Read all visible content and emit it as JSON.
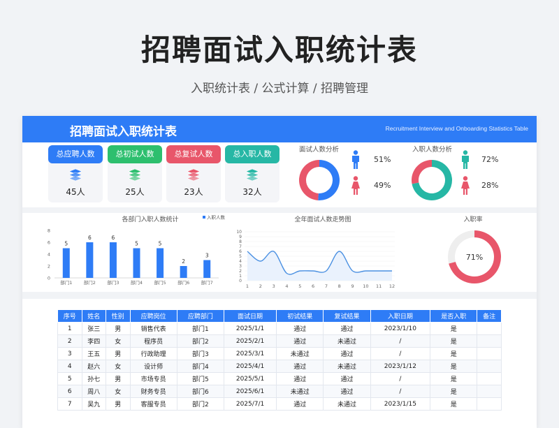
{
  "page": {
    "title": "招聘面试入职统计表",
    "subtitle": "入职统计表 / 公式计算 / 招聘管理"
  },
  "sheet": {
    "title": "招聘面试入职统计表",
    "en_title": "Recruitment Interview and Onboarding Statistics Table"
  },
  "kpis": [
    {
      "label": "总应聘人数",
      "value": "45人",
      "color": "#2e7cf6",
      "icon": "layers-icon"
    },
    {
      "label": "总初试人数",
      "value": "25人",
      "color": "#2dbf6e",
      "icon": "layers-icon"
    },
    {
      "label": "总复试人数",
      "value": "23人",
      "color": "#e8566a",
      "icon": "layers-icon"
    },
    {
      "label": "总入职人数",
      "value": "32人",
      "color": "#26b7a5",
      "icon": "layers-icon"
    }
  ],
  "interview_gender": {
    "title": "面试人数分析",
    "male_pct": "51%",
    "female_pct": "49%",
    "male_value": 51,
    "female_value": 49,
    "male_color": "#2e7cf6",
    "female_color": "#e8566a"
  },
  "onboard_gender": {
    "title": "入职人数分析",
    "male_pct": "72%",
    "female_pct": "28%",
    "male_value": 72,
    "female_value": 28,
    "male_color": "#26b7a5",
    "female_color": "#e8566a"
  },
  "chart_data": [
    {
      "type": "bar",
      "title": "各部门入职人数统计",
      "legend": "入职人数",
      "categories": [
        "部门1",
        "部门2",
        "部门3",
        "部门4",
        "部门5",
        "部门6",
        "部门7"
      ],
      "values": [
        5,
        6,
        6,
        5,
        5,
        2,
        3
      ],
      "ylim": [
        0,
        8
      ],
      "yticks": [
        0,
        2,
        4,
        6,
        8
      ],
      "color": "#2e7cf6"
    },
    {
      "type": "line",
      "title": "全年面试人数走势图",
      "x": [
        1,
        2,
        3,
        4,
        5,
        6,
        7,
        8,
        9,
        10,
        11,
        12
      ],
      "values": [
        6,
        4,
        6,
        1.5,
        2,
        2,
        2,
        6,
        2,
        2,
        2,
        2
      ],
      "ylim": [
        0,
        10
      ],
      "yticks": [
        0,
        1,
        2,
        3,
        4,
        5,
        6,
        7,
        8,
        9,
        10
      ],
      "color": "#4a90e2"
    },
    {
      "type": "pie",
      "title": "入职率",
      "label": "71%",
      "values": [
        71,
        29
      ],
      "colors": [
        "#e8566a",
        "#eeeeee"
      ]
    }
  ],
  "table": {
    "headers": [
      "序号",
      "姓名",
      "性别",
      "应聘岗位",
      "应聘部门",
      "面试日期",
      "初试结果",
      "复试结果",
      "入职日期",
      "是否入职",
      "备注"
    ],
    "rows": [
      [
        "1",
        "张三",
        "男",
        "销售代表",
        "部门1",
        "2025/1/1",
        "通过",
        "通过",
        "2023/1/10",
        "是",
        ""
      ],
      [
        "2",
        "李四",
        "女",
        "程序员",
        "部门2",
        "2025/2/1",
        "通过",
        "未通过",
        "/",
        "是",
        ""
      ],
      [
        "3",
        "王五",
        "男",
        "行政助理",
        "部门3",
        "2025/3/1",
        "未通过",
        "通过",
        "/",
        "是",
        ""
      ],
      [
        "4",
        "赵六",
        "女",
        "设计师",
        "部门4",
        "2025/4/1",
        "通过",
        "未通过",
        "2023/1/12",
        "是",
        ""
      ],
      [
        "5",
        "孙七",
        "男",
        "市场专员",
        "部门5",
        "2025/5/1",
        "通过",
        "通过",
        "/",
        "是",
        ""
      ],
      [
        "6",
        "周八",
        "女",
        "财务专员",
        "部门6",
        "2025/6/1",
        "未通过",
        "通过",
        "/",
        "是",
        ""
      ],
      [
        "7",
        "吴九",
        "男",
        "客服专员",
        "部门2",
        "2025/7/1",
        "通过",
        "未通过",
        "2023/1/15",
        "是",
        ""
      ]
    ]
  }
}
